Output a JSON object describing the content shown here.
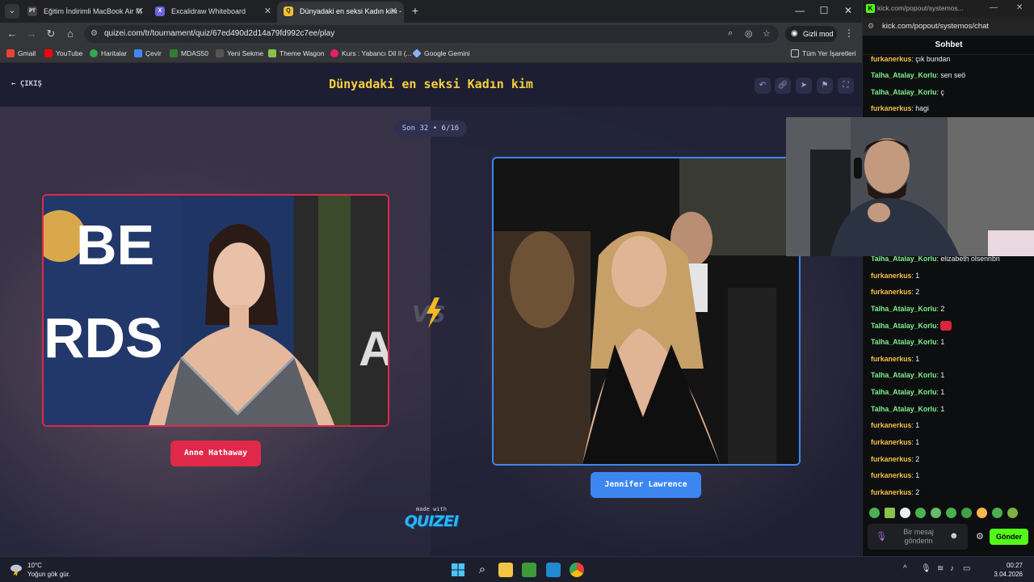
{
  "browser": {
    "tabs": [
      {
        "title": "Eğitim İndirimli MacBook Air M",
        "favicon": "PT"
      },
      {
        "title": "Excalidraw Whiteboard",
        "favicon": "X"
      },
      {
        "title": "Dünyadaki en seksi Kadın kim -",
        "favicon": "Q"
      }
    ],
    "url": "quizei.com/tr/tournament/quiz/67ed490d2d14a79fd992c7ee/play",
    "incognito_label": "Gizli mod",
    "bookmarks": [
      "Gmail",
      "YouTube",
      "Haritalar",
      "Çevir",
      "MDAS50",
      "Yeni Sekme",
      "Theme Wagon",
      "Kurs : Yabancı Dil II (...",
      "Google Gemini"
    ],
    "all_bookmarks_label": "Tüm Yer İşaretleri"
  },
  "quiz": {
    "back_label": "ÇIKIŞ",
    "title": "Dünyadaki en seksi Kadın kim",
    "round": "Son 32 • 6/16",
    "left_name": "Anne Hathaway",
    "right_name": "Jennifer Lawrence",
    "made_with": "made with",
    "logo": "QUIZEI"
  },
  "kick": {
    "window_title": "kick.com/popout/systemos...",
    "url": "kick.com/popout/systemos/chat",
    "chat_title": "Sohbet",
    "user_colors": {
      "furkanerkus": "#f5c04a",
      "Talha_Atalay_Korlu": "#7cf28a"
    },
    "messages": [
      {
        "user": "furkanerkus",
        "text": "çık bundan"
      },
      {
        "user": "Talha_Atalay_Korlu",
        "text": "sen seö"
      },
      {
        "user": "Talha_Atalay_Korlu",
        "text": "ç"
      },
      {
        "user": "furkanerkus",
        "text": "hagi"
      },
      {
        "user": "Talha_Atalay_Korlu",
        "text": "elizabeth olsennbn"
      },
      {
        "user": "furkanerkus",
        "text": "1"
      },
      {
        "user": "furkanerkus",
        "text": "2"
      },
      {
        "user": "Talha_Atalay_Korlu",
        "text": "2"
      },
      {
        "user": "Talha_Atalay_Korlu",
        "text": ""
      },
      {
        "user": "Talha_Atalay_Korlu",
        "text": "1"
      },
      {
        "user": "furkanerkus",
        "text": "1"
      },
      {
        "user": "Talha_Atalay_Korlu",
        "text": "1"
      },
      {
        "user": "Talha_Atalay_Korlu",
        "text": "1"
      },
      {
        "user": "Talha_Atalay_Korlu",
        "text": "1"
      },
      {
        "user": "furkanerkus",
        "text": "1"
      },
      {
        "user": "furkanerkus",
        "text": "1"
      },
      {
        "user": "furkanerkus",
        "text": "2"
      },
      {
        "user": "furkanerkus",
        "text": "1"
      },
      {
        "user": "furkanerkus",
        "text": "2"
      }
    ],
    "input_placeholder": "Bir mesaj gönderin",
    "send_label": "Gönder"
  },
  "taskbar": {
    "temperature": "10°C",
    "weather": "Yoğun gök gür.",
    "time": "00:27",
    "date": "3.04.2026"
  }
}
